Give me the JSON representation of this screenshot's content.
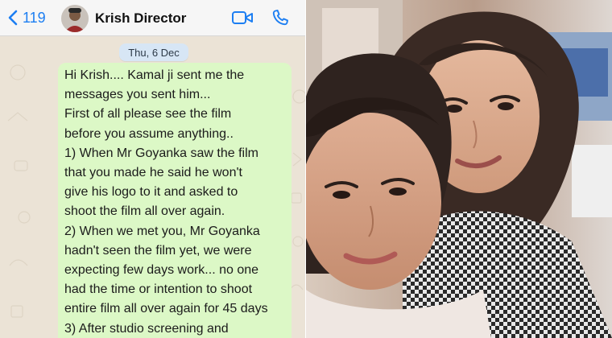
{
  "chat": {
    "back_count": "119",
    "contact_name": "Krish Director",
    "date_label": "Thu, 6 Dec",
    "message_lines": [
      "Hi Krish.... Kamal ji sent me the",
      "messages you sent him...",
      "First of all please see the film",
      "before you assume anything..",
      "1) When Mr Goyanka saw the film",
      "that you made he said he won't",
      "give his logo to it and asked to",
      "shoot the film all over again.",
      "2) When we met you, Mr Goyanka",
      "hadn't seen the film yet, we were",
      "expecting few days work... no one",
      "had the time or intention to shoot",
      "entire film all over again for 45 days",
      "3) After studio screening and"
    ],
    "icons": {
      "back": "chevron-left-icon",
      "video": "video-camera-icon",
      "phone": "phone-icon"
    },
    "colors": {
      "accent": "#1c7ef2",
      "bubble": "#dcf8c6",
      "date_pill": "#d7e6f5"
    }
  },
  "photo": {
    "description_icon": "photo"
  }
}
